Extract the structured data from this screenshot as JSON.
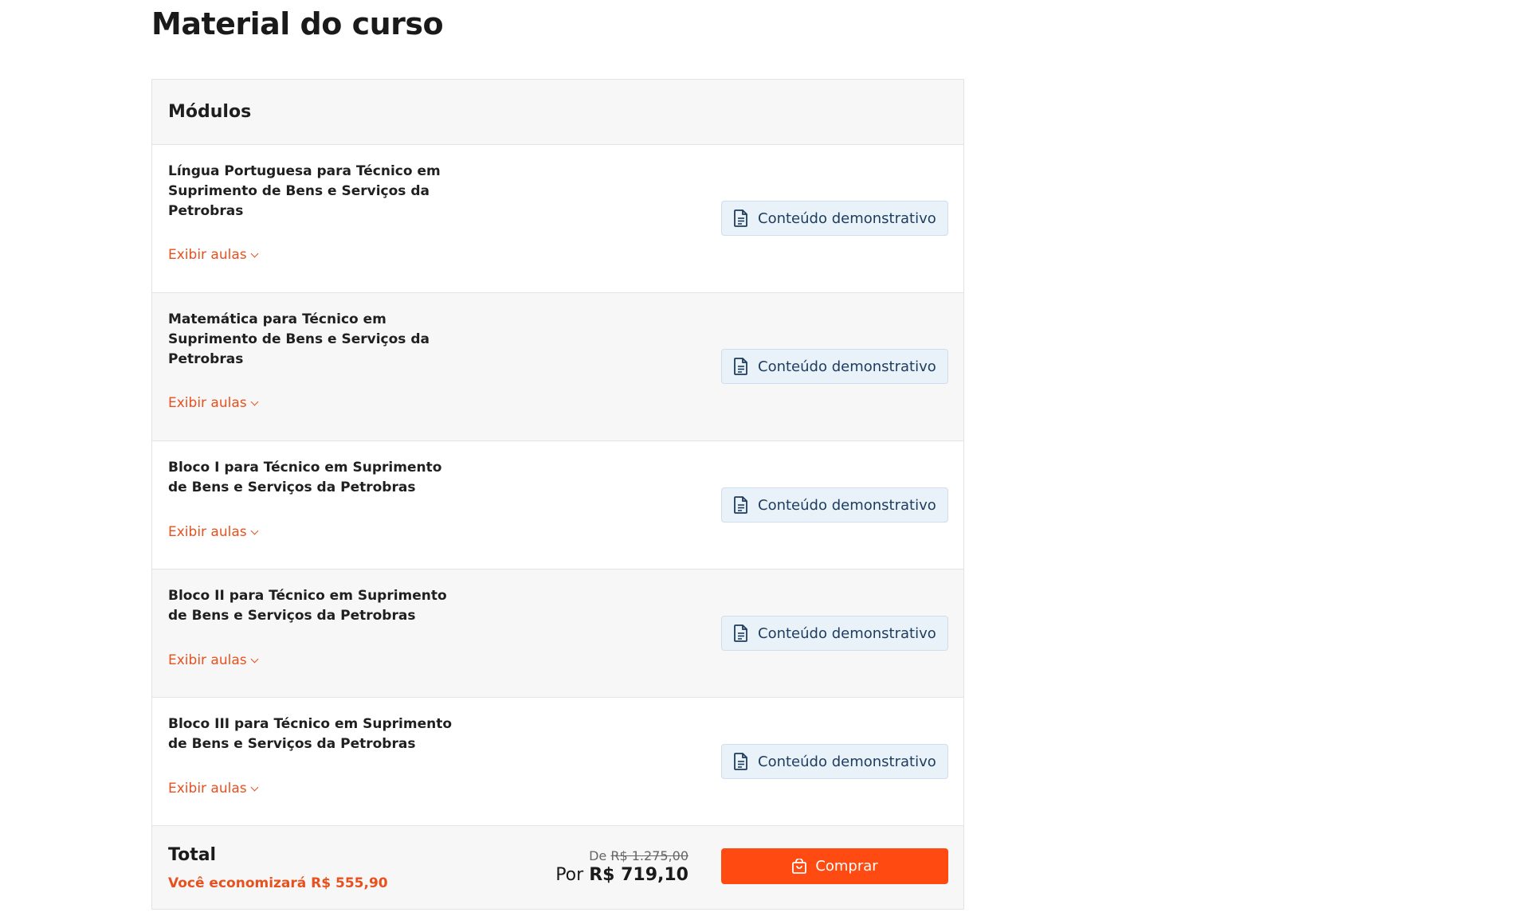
{
  "page": {
    "title": "Material do curso"
  },
  "table": {
    "header": "Módulos",
    "modules": [
      {
        "title": "Língua Portuguesa para Técnico em Suprimento de Bens e Serviços da Petrobras",
        "toggle_label": "Exibir aulas",
        "demo_label": "Conteúdo demonstrativo"
      },
      {
        "title": "Matemática para Técnico em Suprimento de Bens e Serviços da Petrobras",
        "toggle_label": "Exibir aulas",
        "demo_label": "Conteúdo demonstrativo"
      },
      {
        "title": "Bloco I para Técnico em Suprimento de Bens e Serviços da Petrobras",
        "toggle_label": "Exibir aulas",
        "demo_label": "Conteúdo demonstrativo"
      },
      {
        "title": "Bloco II para Técnico em Suprimento de Bens e Serviços da Petrobras",
        "toggle_label": "Exibir aulas",
        "demo_label": "Conteúdo demonstrativo"
      },
      {
        "title": "Bloco III para Técnico em Suprimento de Bens e Serviços da Petrobras",
        "toggle_label": "Exibir aulas",
        "demo_label": "Conteúdo demonstrativo"
      }
    ]
  },
  "total": {
    "label": "Total",
    "savings": "Você economizará R$ 555,90",
    "old_prefix": "De",
    "old_price": "R$ 1.275,00",
    "new_prefix": "Por",
    "new_price": "R$ 719,10",
    "buy_label": "Comprar"
  },
  "colors": {
    "accent": "#ff4b12",
    "link": "#e8501e",
    "demo_bg": "#e9f1f9",
    "demo_text": "#1d3c5e"
  },
  "icons": {
    "demo": "document-icon",
    "buy": "shopping-bag-icon",
    "toggle": "chevron-down-icon"
  }
}
